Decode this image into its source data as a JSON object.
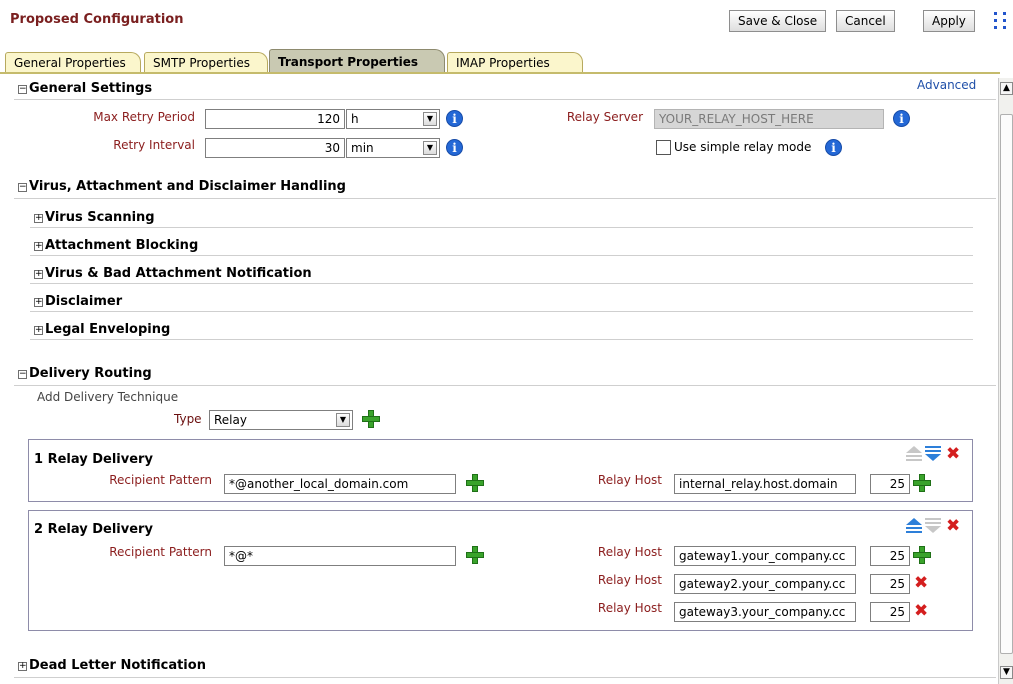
{
  "header": {
    "title": "Proposed Configuration",
    "save_close": "Save & Close",
    "cancel": "Cancel",
    "apply": "Apply"
  },
  "tabs": [
    {
      "label": "General Properties",
      "active": false
    },
    {
      "label": "SMTP Properties",
      "active": false
    },
    {
      "label": "Transport Properties",
      "active": true
    },
    {
      "label": "IMAP Properties",
      "active": false
    }
  ],
  "general_settings": {
    "title": "General Settings",
    "advanced_link": "Advanced",
    "max_retry_label": "Max Retry Period",
    "max_retry_value": "120",
    "max_retry_unit": "h",
    "retry_interval_label": "Retry Interval",
    "retry_interval_value": "30",
    "retry_interval_unit": "min",
    "relay_server_label": "Relay Server",
    "relay_server_value": "YOUR_RELAY_HOST_HERE",
    "simple_relay_label": "Use simple relay mode"
  },
  "virus_section": {
    "title": "Virus, Attachment and Disclaimer Handling",
    "items": [
      "Virus Scanning",
      "Attachment Blocking",
      "Virus & Bad Attachment Notification",
      "Disclaimer",
      "Legal Enveloping"
    ]
  },
  "delivery_routing": {
    "title": "Delivery Routing",
    "add_technique_label": "Add Delivery Technique",
    "type_label": "Type",
    "type_value": "Relay",
    "deliveries": [
      {
        "title": "1 Relay Delivery",
        "pattern_label": "Recipient Pattern",
        "pattern_value": "*@another_local_domain.com",
        "hosts": [
          {
            "label": "Relay Host",
            "host": "internal_relay.host.domain",
            "port": "25"
          }
        ]
      },
      {
        "title": "2 Relay Delivery",
        "pattern_label": "Recipient Pattern",
        "pattern_value": "*@*",
        "hosts": [
          {
            "label": "Relay Host",
            "host": "gateway1.your_company.cc",
            "port": "25"
          },
          {
            "label": "Relay Host",
            "host": "gateway2.your_company.cc",
            "port": "25"
          },
          {
            "label": "Relay Host",
            "host": "gateway3.your_company.cc",
            "port": "25"
          }
        ]
      }
    ]
  },
  "dead_letter": {
    "title": "Dead Letter Notification"
  },
  "icons": {
    "info": "i",
    "toggle_collapse": "−",
    "toggle_expand": "+"
  },
  "colors": {
    "label_red": "#8b1d1d",
    "tab_yellow": "#fbf6cc",
    "info_blue": "#2468d6",
    "plus_green": "#3aa32b",
    "delete_red": "#d41e1e"
  }
}
